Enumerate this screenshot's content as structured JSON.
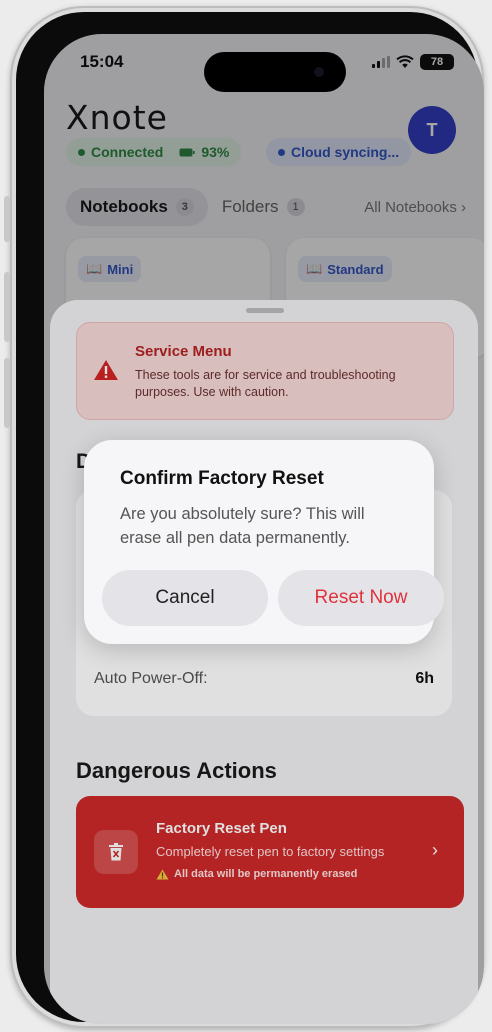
{
  "status_bar": {
    "time": "15:04",
    "battery": "78"
  },
  "app": {
    "logo": "Xnote",
    "avatar_initial": "T"
  },
  "status_chips": {
    "connection": "Connected",
    "battery": "93%",
    "sync": "Cloud syncing..."
  },
  "tabs": [
    {
      "label": "Notebooks",
      "count": "3"
    },
    {
      "label": "Folders",
      "count": "1"
    }
  ],
  "tabs_link": "All Notebooks",
  "notebooks": [
    {
      "tag": "Mini"
    },
    {
      "tag": "Standard"
    }
  ],
  "service_menu": {
    "title": "Service Menu",
    "description": "These tools are for service and troubleshooting purposes. Use with caution."
  },
  "device_section": {
    "title_partial": "D",
    "auto_power_off_label": "Auto Power-Off:",
    "auto_power_off_value": "6h"
  },
  "danger_zone": {
    "title": "Dangerous Actions",
    "reset_card": {
      "title": "Factory Reset Pen",
      "subtitle": "Completely reset pen to factory settings",
      "warning": "All data will be permanently erased"
    }
  },
  "dialog": {
    "title": "Confirm Factory Reset",
    "message": "Are you absolutely sure? This will erase all pen data permanently.",
    "cancel_label": "Cancel",
    "confirm_label": "Reset Now"
  },
  "colors": {
    "accent_blue": "#3440c8",
    "danger_red": "#cf2a2a",
    "destructive_text": "#e0323b",
    "connected_green": "#2e8b47"
  }
}
